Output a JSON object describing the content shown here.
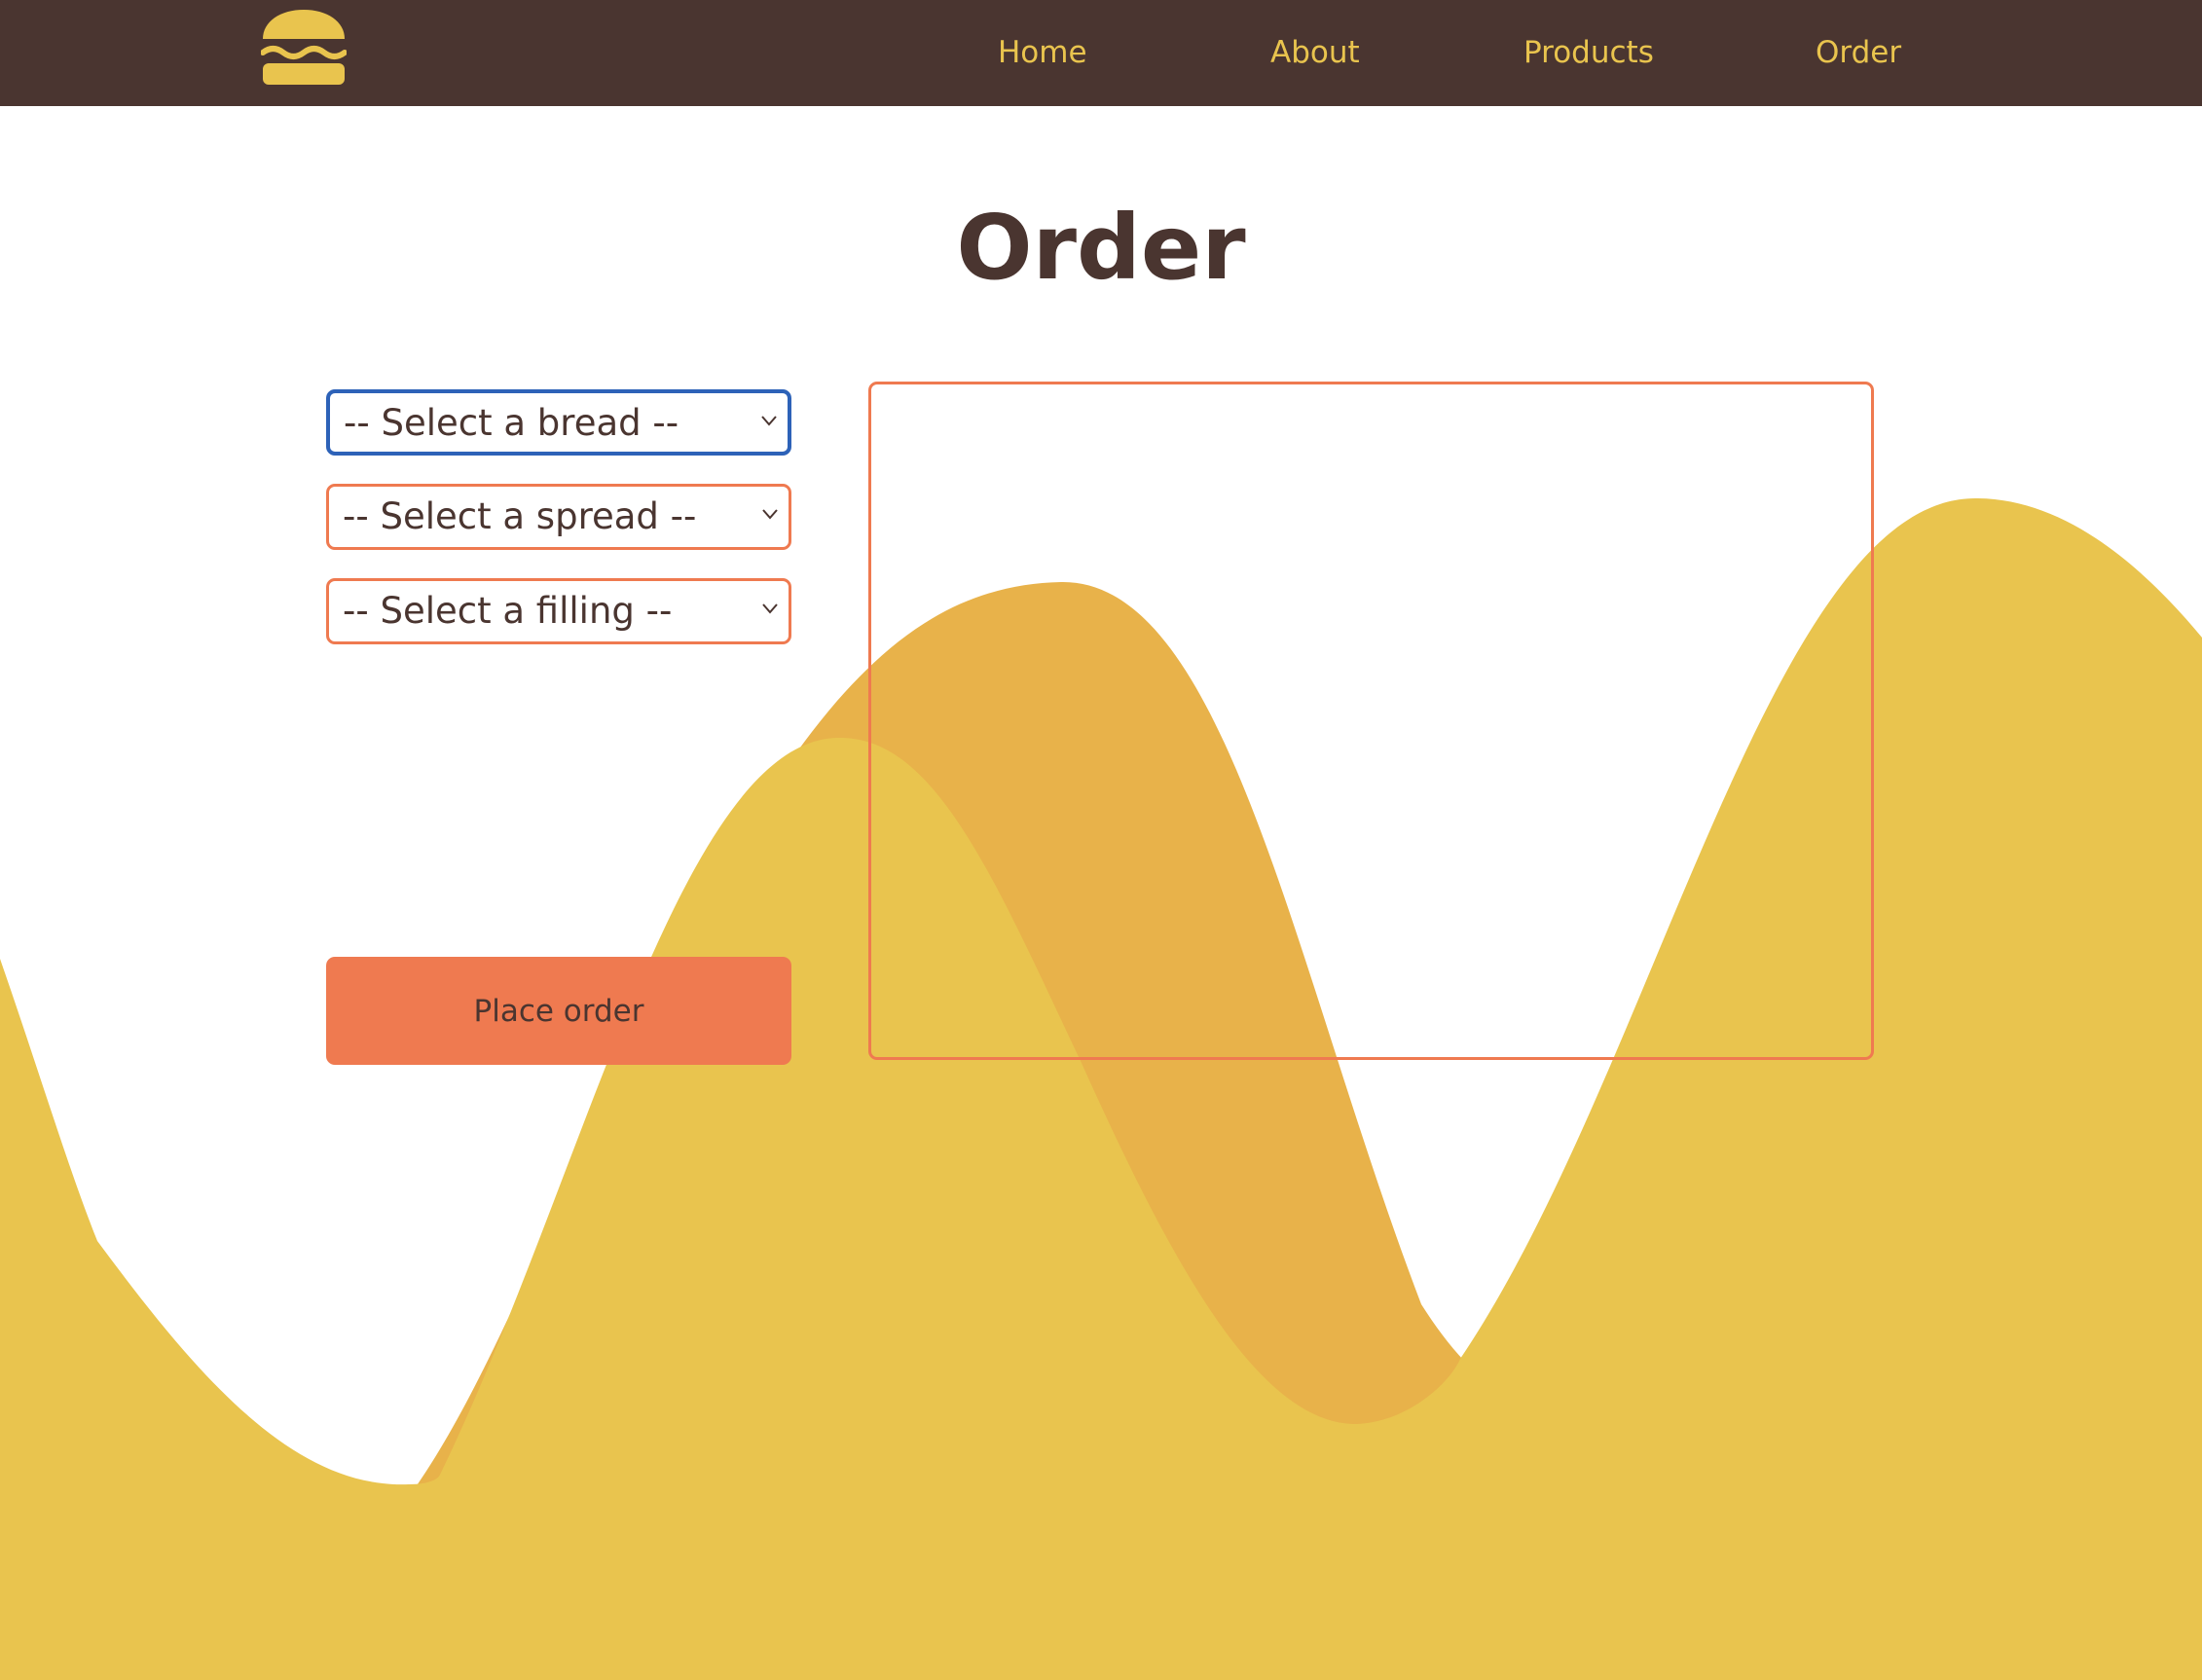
{
  "nav": {
    "logo_icon": "burger-icon",
    "items": [
      {
        "label": "Home"
      },
      {
        "label": "About"
      },
      {
        "label": "Products"
      },
      {
        "label": "Order"
      }
    ]
  },
  "page": {
    "title": "Order"
  },
  "form": {
    "bread_select": {
      "selected": "-- Select a bread --"
    },
    "spread_select": {
      "selected": "-- Select a spread --"
    },
    "filling_select": {
      "selected": "-- Select a filling --"
    },
    "submit_label": "Place order"
  },
  "colors": {
    "navbar": "#4a3530",
    "accent_yellow": "#e9c44e",
    "wave_back": "#e8b24a",
    "wave_front": "#e9c44e",
    "orange": "#ef7a50",
    "focus_blue": "#2d62b8",
    "text_dark": "#4a3530"
  }
}
